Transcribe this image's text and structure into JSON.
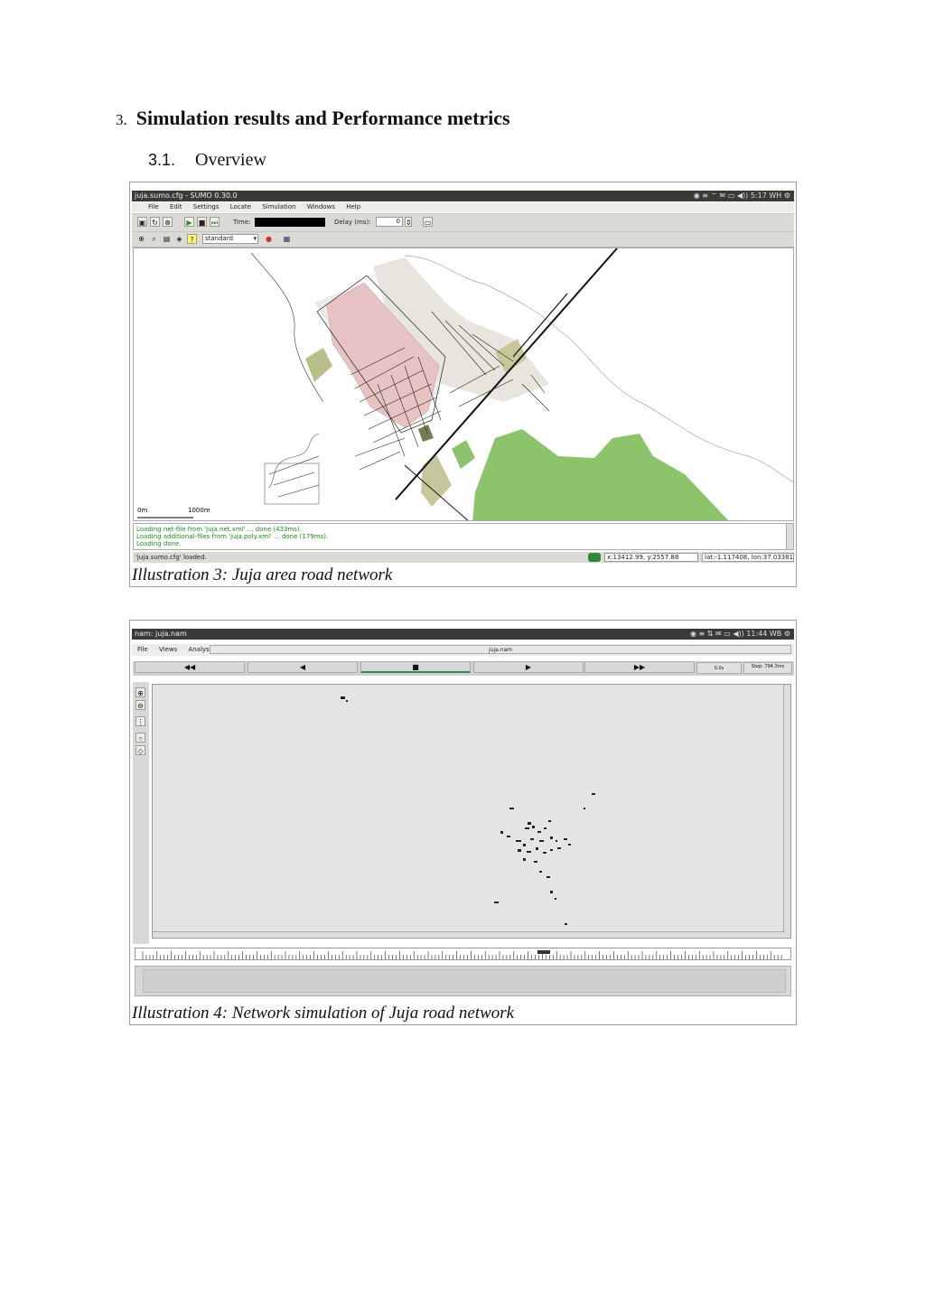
{
  "section": {
    "number": "3.",
    "title": "Simulation results and Performance metrics"
  },
  "subsection": {
    "number": "3.1.",
    "title": "Overview"
  },
  "figure1": {
    "caption": "Illustration 3: Juja area road network",
    "window_title": "juja.sumo.cfg - SUMO 0.30.0",
    "tray_text": "5:17 WH",
    "menu": [
      "File",
      "Edit",
      "Settings",
      "Locate",
      "Simulation",
      "Windows",
      "Help"
    ],
    "time_label": "Time:",
    "delay_label": "Delay (ms):",
    "delay_value": "0",
    "scheme_value": "standard",
    "scale_start": "0m",
    "scale_end": "1000m",
    "log_lines": [
      "Loading net-file from 'juja.net.xml' ... done (433ms).",
      "Loading additional-files from 'juja.poly.xml' ... done (179ms).",
      "Loading done."
    ],
    "status_text": "'juja.sumo.cfg' loaded.",
    "coords_xy": "x:13412.99, y:2557.88",
    "coords_latlon": "lat:-1.117408, lon:37.033818",
    "colors": {
      "industrial": "#e7c3c3",
      "park": "#8bc46a",
      "field": "#b9bf86",
      "road": "#111111",
      "residential": "#dedcd4"
    }
  },
  "figure2": {
    "caption": "Illustration 4: Network simulation of Juja road network",
    "window_title": "nam: juja.nam",
    "tray_text": "11:44 WB",
    "menu": [
      "File",
      "Views",
      "Analysis"
    ],
    "file_label": "juja.nam",
    "controls": [
      "◀◀",
      "◀",
      "■",
      "▶",
      "▶▶"
    ],
    "time_value": "0.0s",
    "step_value": "Step: 794.3ms"
  }
}
